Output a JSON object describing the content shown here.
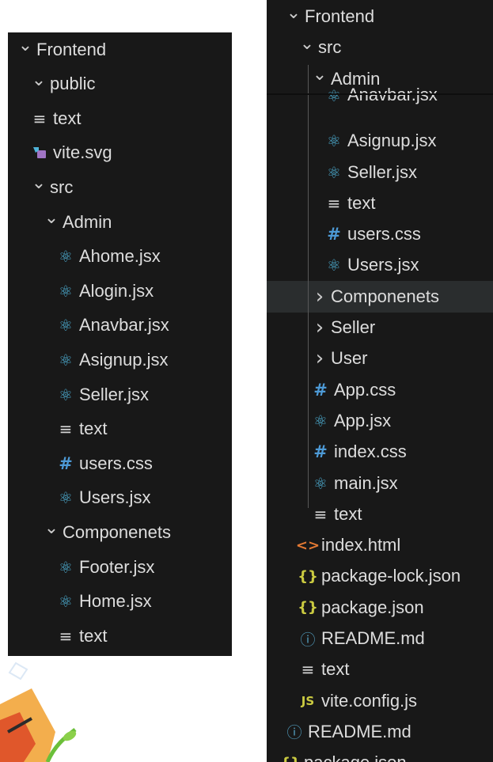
{
  "left_tree": [
    {
      "label": "Frontend",
      "depth": 0,
      "kind": "folder-open"
    },
    {
      "label": "public",
      "depth": 1,
      "kind": "folder-open"
    },
    {
      "label": "text",
      "depth": 1,
      "kind": "text"
    },
    {
      "label": "vite.svg",
      "depth": 1,
      "kind": "svg"
    },
    {
      "label": "src",
      "depth": 1,
      "kind": "folder-open"
    },
    {
      "label": "Admin",
      "depth": 2,
      "kind": "folder-open"
    },
    {
      "label": "Ahome.jsx",
      "depth": 3,
      "kind": "react"
    },
    {
      "label": "Alogin.jsx",
      "depth": 3,
      "kind": "react"
    },
    {
      "label": "Anavbar.jsx",
      "depth": 3,
      "kind": "react"
    },
    {
      "label": "Asignup.jsx",
      "depth": 3,
      "kind": "react"
    },
    {
      "label": "Seller.jsx",
      "depth": 3,
      "kind": "react"
    },
    {
      "label": "text",
      "depth": 3,
      "kind": "text"
    },
    {
      "label": "users.css",
      "depth": 3,
      "kind": "css"
    },
    {
      "label": "Users.jsx",
      "depth": 3,
      "kind": "react"
    },
    {
      "label": "Componenets",
      "depth": 2,
      "kind": "folder-open"
    },
    {
      "label": "Footer.jsx",
      "depth": 3,
      "kind": "react"
    },
    {
      "label": "Home.jsx",
      "depth": 3,
      "kind": "react"
    },
    {
      "label": "text",
      "depth": 3,
      "kind": "text"
    }
  ],
  "right_tree": [
    {
      "label": "Frontend",
      "depth": 0,
      "kind": "folder-open"
    },
    {
      "label": "src",
      "depth": 1,
      "kind": "folder-open"
    },
    {
      "label": "Admin",
      "depth": 2,
      "kind": "folder-open"
    },
    {
      "label": "Anavbar.jsx",
      "depth": 3,
      "kind": "react",
      "partial": true
    },
    {
      "label": "Asignup.jsx",
      "depth": 3,
      "kind": "react"
    },
    {
      "label": "Seller.jsx",
      "depth": 3,
      "kind": "react"
    },
    {
      "label": "text",
      "depth": 3,
      "kind": "text"
    },
    {
      "label": "users.css",
      "depth": 3,
      "kind": "css"
    },
    {
      "label": "Users.jsx",
      "depth": 3,
      "kind": "react"
    },
    {
      "label": "Componenets",
      "depth": 2,
      "kind": "folder-closed",
      "hovered": true
    },
    {
      "label": "Seller",
      "depth": 2,
      "kind": "folder-closed"
    },
    {
      "label": "User",
      "depth": 2,
      "kind": "folder-closed"
    },
    {
      "label": "App.css",
      "depth": 2,
      "kind": "css"
    },
    {
      "label": "App.jsx",
      "depth": 2,
      "kind": "react"
    },
    {
      "label": "index.css",
      "depth": 2,
      "kind": "css"
    },
    {
      "label": "main.jsx",
      "depth": 2,
      "kind": "react"
    },
    {
      "label": "text",
      "depth": 2,
      "kind": "text"
    },
    {
      "label": "index.html",
      "depth": 1,
      "kind": "html"
    },
    {
      "label": "package-lock.json",
      "depth": 1,
      "kind": "json"
    },
    {
      "label": "package.json",
      "depth": 1,
      "kind": "json"
    },
    {
      "label": "README.md",
      "depth": 1,
      "kind": "info"
    },
    {
      "label": "text",
      "depth": 1,
      "kind": "text"
    },
    {
      "label": "vite.config.js",
      "depth": 1,
      "kind": "js"
    },
    {
      "label": "README.md",
      "depth": 0,
      "kind": "info"
    },
    {
      "label": "package.json",
      "depth": -0.3,
      "kind": "json"
    }
  ],
  "icons": {
    "folder-open": "chevron-down-icon",
    "folder-closed": "chevron-right-icon",
    "react": "react-icon",
    "text": "text-lines-icon",
    "css": "hash-icon",
    "svg": "svg-file-icon",
    "html": "html-code-icon",
    "json": "json-braces-icon",
    "info": "info-circle-icon",
    "js": "js-file-icon"
  },
  "colors": {
    "panel_bg": "#181818",
    "hover_bg": "#2a2d2e",
    "react_blue": "#4fb3d9",
    "css_blue": "#4d9ad6",
    "json_yellow": "#cbcb41",
    "html_orange": "#e37933",
    "svg_purple": "#a074c4"
  }
}
